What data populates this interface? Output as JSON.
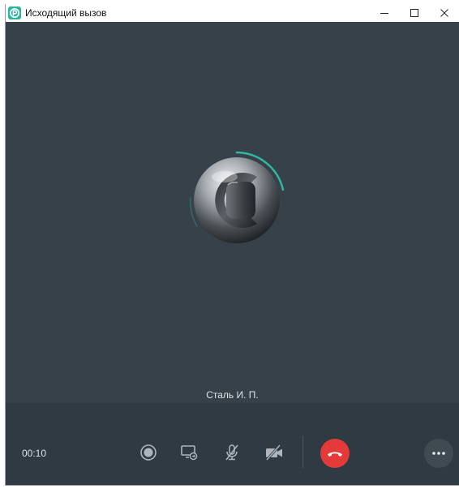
{
  "window": {
    "title": "Исходящий вызов",
    "controls": [
      "minimize-icon",
      "maximize-icon",
      "close-icon"
    ]
  },
  "call": {
    "caller_name": "Сталь И. П.",
    "duration": "00:10",
    "avatar_icon": "steel-c-logo"
  },
  "toolbar": {
    "buttons": [
      {
        "name": "record-button",
        "icon": "record-icon"
      },
      {
        "name": "screen-share-button",
        "icon": "screen-share-icon"
      },
      {
        "name": "mute-button",
        "icon": "mic-off-icon"
      },
      {
        "name": "video-button",
        "icon": "camera-off-icon"
      },
      {
        "name": "hangup-button",
        "icon": "phone-hangup-icon"
      },
      {
        "name": "more-button",
        "icon": "more-dots-icon"
      }
    ]
  },
  "colors": {
    "background": "#37414a",
    "bottom_bar": "#303a42",
    "hangup": "#e53a3a",
    "icon": "#aeb5bb",
    "progress_ring": "#2fb7a0",
    "app_icon": "#2bb5a0"
  }
}
